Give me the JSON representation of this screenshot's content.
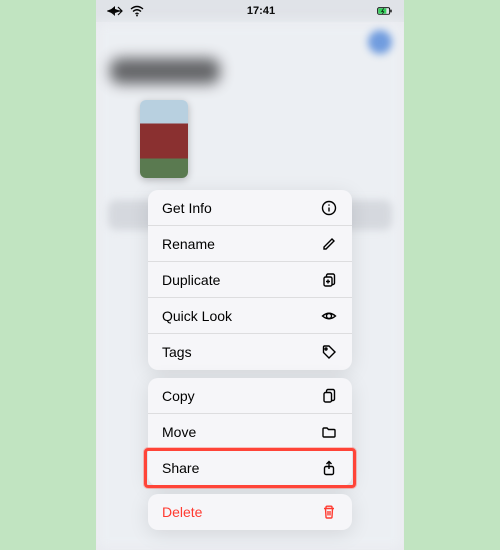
{
  "status_bar": {
    "time": "17:41"
  },
  "background": {
    "title": "Recents"
  },
  "menu": {
    "groups": [
      {
        "items": [
          {
            "id": "get-info",
            "label": "Get Info",
            "icon": "info",
            "destructive": false
          },
          {
            "id": "rename",
            "label": "Rename",
            "icon": "pencil",
            "destructive": false
          },
          {
            "id": "duplicate",
            "label": "Duplicate",
            "icon": "duplicate",
            "destructive": false
          },
          {
            "id": "quick-look",
            "label": "Quick Look",
            "icon": "eye",
            "destructive": false
          },
          {
            "id": "tags",
            "label": "Tags",
            "icon": "tag",
            "destructive": false
          }
        ]
      },
      {
        "items": [
          {
            "id": "copy",
            "label": "Copy",
            "icon": "copy",
            "destructive": false
          },
          {
            "id": "move",
            "label": "Move",
            "icon": "folder",
            "destructive": false
          },
          {
            "id": "share",
            "label": "Share",
            "icon": "share",
            "destructive": false,
            "highlighted": true
          }
        ]
      },
      {
        "items": [
          {
            "id": "delete",
            "label": "Delete",
            "icon": "trash",
            "destructive": true
          }
        ]
      }
    ]
  }
}
